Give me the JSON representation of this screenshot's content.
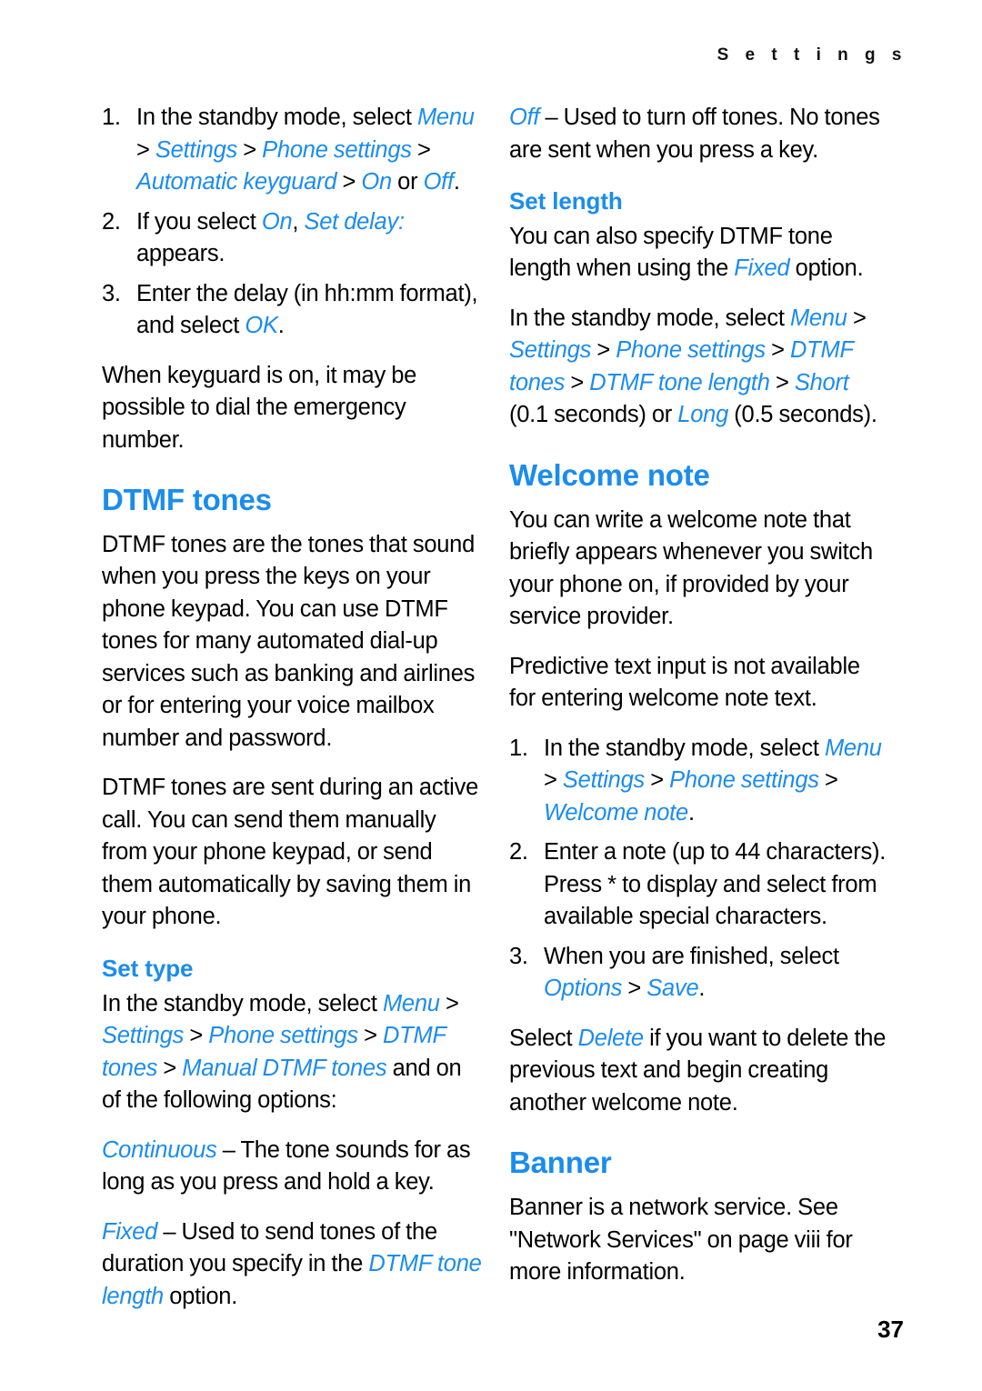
{
  "header": {
    "running_title": "S e t t i n g s"
  },
  "footer": {
    "page_number": "37"
  },
  "colors": {
    "heading_blue": "#1a8cf0",
    "body_black": "#000000",
    "background": "#ffffff"
  },
  "left_column": {
    "keyguard_steps": [
      {
        "marker": "1.",
        "segments": [
          {
            "text": "In the standby mode, select ",
            "style": "plain"
          },
          {
            "text": "Menu",
            "style": "ui"
          },
          {
            "text": " > ",
            "style": "plain"
          },
          {
            "text": "Settings",
            "style": "ui"
          },
          {
            "text": " > ",
            "style": "plain"
          },
          {
            "text": "Phone settings",
            "style": "ui"
          },
          {
            "text": " > ",
            "style": "plain"
          },
          {
            "text": "Automatic keyguard",
            "style": "ui"
          },
          {
            "text": " > ",
            "style": "plain"
          },
          {
            "text": "On",
            "style": "ui"
          },
          {
            "text": " or ",
            "style": "plain"
          },
          {
            "text": "Off",
            "style": "ui"
          },
          {
            "text": ".",
            "style": "plain"
          }
        ]
      },
      {
        "marker": "2.",
        "segments": [
          {
            "text": "If you select ",
            "style": "plain"
          },
          {
            "text": "On",
            "style": "ui"
          },
          {
            "text": ", ",
            "style": "plain"
          },
          {
            "text": "Set delay:",
            "style": "ui"
          },
          {
            "text": " appears.",
            "style": "plain"
          }
        ]
      },
      {
        "marker": "3.",
        "segments": [
          {
            "text": "Enter the delay (in hh:mm format), and select ",
            "style": "plain"
          },
          {
            "text": "OK",
            "style": "ui"
          },
          {
            "text": ".",
            "style": "plain"
          }
        ]
      }
    ],
    "keyguard_note": "When keyguard is on, it may be possible to dial the emergency number.",
    "dtmf_heading": "DTMF tones",
    "dtmf_para_1": "DTMF tones are the tones that sound when you press the keys on your phone keypad. You can use DTMF tones for many automated dial-up services such as banking and airlines or for entering your voice mailbox number and password.",
    "dtmf_para_2": "DTMF tones are sent during an active call. You can send them manually from your phone keypad, or send them automatically by saving them in your phone.",
    "set_type_heading": "Set type",
    "set_type_path": [
      {
        "text": "In the standby mode, select ",
        "style": "plain"
      },
      {
        "text": "Menu",
        "style": "ui"
      },
      {
        "text": " > ",
        "style": "plain"
      },
      {
        "text": "Settings",
        "style": "ui"
      },
      {
        "text": " > ",
        "style": "plain"
      },
      {
        "text": "Phone settings",
        "style": "ui"
      },
      {
        "text": " > ",
        "style": "plain"
      },
      {
        "text": "DTMF tones",
        "style": "ui"
      },
      {
        "text": " > ",
        "style": "plain"
      },
      {
        "text": "Manual DTMF tones",
        "style": "ui"
      },
      {
        "text": " and on of the following options:",
        "style": "plain"
      }
    ],
    "option_continuous": [
      {
        "text": "Continuous",
        "style": "ui"
      },
      {
        "text": " – The tone sounds for as long as you press and hold a key.",
        "style": "plain"
      }
    ],
    "option_fixed": [
      {
        "text": "Fixed",
        "style": "ui"
      },
      {
        "text": " – Used to send tones of the duration you specify in the ",
        "style": "plain"
      },
      {
        "text": "DTMF tone length",
        "style": "ui"
      },
      {
        "text": " option.",
        "style": "plain"
      }
    ]
  },
  "right_column": {
    "option_off": [
      {
        "text": "Off",
        "style": "ui"
      },
      {
        "text": " – Used to turn off tones. No tones are sent when you press a key.",
        "style": "plain"
      }
    ],
    "set_length_heading": "Set length",
    "set_length_para": [
      {
        "text": "You can also specify DTMF tone length when using the ",
        "style": "plain"
      },
      {
        "text": "Fixed",
        "style": "ui"
      },
      {
        "text": " option.",
        "style": "plain"
      }
    ],
    "set_length_path": [
      {
        "text": "In the standby mode, select ",
        "style": "plain"
      },
      {
        "text": "Menu",
        "style": "ui"
      },
      {
        "text": " > ",
        "style": "plain"
      },
      {
        "text": "Settings",
        "style": "ui"
      },
      {
        "text": " > ",
        "style": "plain"
      },
      {
        "text": "Phone settings",
        "style": "ui"
      },
      {
        "text": " > ",
        "style": "plain"
      },
      {
        "text": "DTMF tones",
        "style": "ui"
      },
      {
        "text": " > ",
        "style": "plain"
      },
      {
        "text": "DTMF tone length",
        "style": "ui"
      },
      {
        "text": " > ",
        "style": "plain"
      },
      {
        "text": "Short",
        "style": "ui"
      },
      {
        "text": " (0.1 seconds) or ",
        "style": "plain"
      },
      {
        "text": "Long",
        "style": "ui"
      },
      {
        "text": " (0.5 seconds).",
        "style": "plain"
      }
    ],
    "welcome_heading": "Welcome note",
    "welcome_para_1": "You can write a welcome note that briefly appears whenever you switch your phone on, if provided by your service provider.",
    "welcome_para_2": "Predictive text input is not available for entering welcome note text.",
    "welcome_steps": [
      {
        "marker": "1.",
        "segments": [
          {
            "text": "In the standby mode, select ",
            "style": "plain"
          },
          {
            "text": "Menu",
            "style": "ui"
          },
          {
            "text": " > ",
            "style": "plain"
          },
          {
            "text": "Settings",
            "style": "ui"
          },
          {
            "text": " > ",
            "style": "plain"
          },
          {
            "text": "Phone settings",
            "style": "ui"
          },
          {
            "text": " > ",
            "style": "plain"
          },
          {
            "text": "Welcome note",
            "style": "ui"
          },
          {
            "text": ".",
            "style": "plain"
          }
        ]
      },
      {
        "marker": "2.",
        "segments": [
          {
            "text": "Enter a note (up to 44 characters). Press * to display and select from available special characters.",
            "style": "plain"
          }
        ]
      },
      {
        "marker": "3.",
        "segments": [
          {
            "text": "When you are finished, select ",
            "style": "plain"
          },
          {
            "text": "Options",
            "style": "ui"
          },
          {
            "text": " > ",
            "style": "plain"
          },
          {
            "text": "Save",
            "style": "ui"
          },
          {
            "text": ".",
            "style": "plain"
          }
        ]
      }
    ],
    "delete_para": [
      {
        "text": "Select ",
        "style": "plain"
      },
      {
        "text": "Delete",
        "style": "ui"
      },
      {
        "text": " if you want to delete the previous text and begin creating another welcome note.",
        "style": "plain"
      }
    ],
    "banner_heading": "Banner",
    "banner_para": "Banner is a network service. See \"Network Services\" on page viii for more information."
  }
}
